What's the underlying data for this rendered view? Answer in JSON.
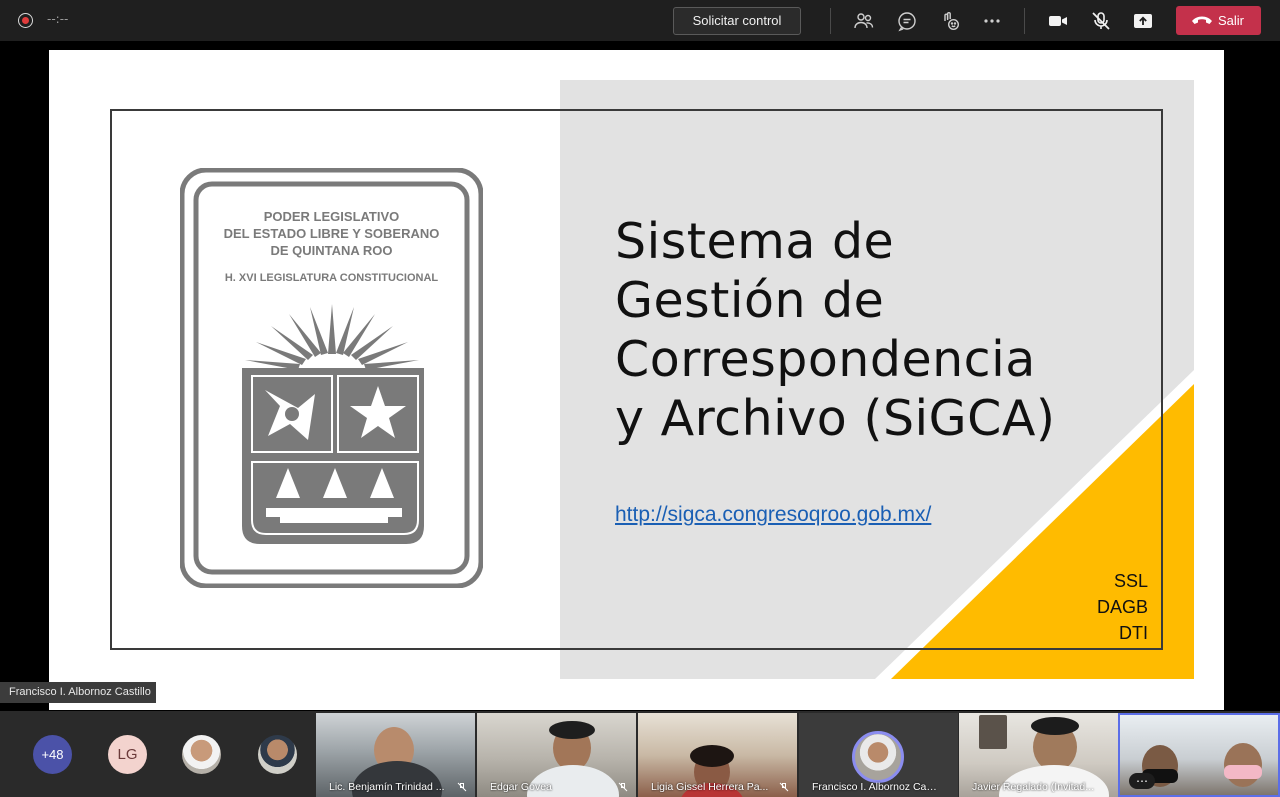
{
  "topbar": {
    "timer": "--:--",
    "request_control": "Solicitar control",
    "leave": "Salir",
    "icons": [
      "participants-icon",
      "chat-icon",
      "reactions-icon",
      "more-options-icon",
      "camera-icon",
      "mic-muted-icon",
      "share-icon",
      "hangup-icon"
    ],
    "leave_color": "#c4314b"
  },
  "slide": {
    "seal_lines": [
      "PODER LEGISLATIVO",
      "DEL ESTADO LIBRE Y SOBERANO",
      "DE QUINTANA ROO"
    ],
    "seal_subtitle": "H. XVI LEGISLATURA CONSTITUCIONAL",
    "title_lines": [
      "Sistema de",
      "Gestión de",
      "Correspondencia",
      "y Archivo (SiGCA)"
    ],
    "url": "http://sigca.congresoqroo.gob.mx/",
    "tags": [
      "SSL",
      "DAGB",
      "DTI"
    ],
    "accent_color": "#ffbb00"
  },
  "presenter_label": "Francisco I. Albornoz Castillo",
  "participants": {
    "more_count": "+48",
    "initials": "LG",
    "tiles": [
      {
        "name": "Lic. Benjamín Trinidad ..."
      },
      {
        "name": "Edgar Govea"
      },
      {
        "name": "Ligia Gissel Herrera Pa..."
      },
      {
        "name": "Francisco I. Albornoz Casti..."
      },
      {
        "name": "Javier Regalado (Invitad..."
      },
      {
        "name": ""
      }
    ]
  }
}
